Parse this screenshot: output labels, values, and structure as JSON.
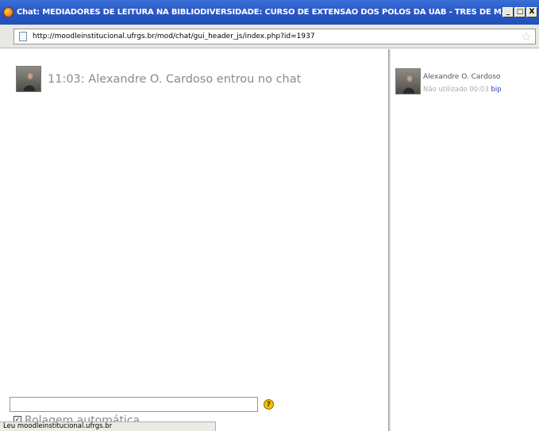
{
  "window": {
    "title": "Chat: MEDIADORES DE LEITURA NA BIBLIODIVERSIDADE: CURSO DE EXTENSÃO DOS PÓLOS DA UAB - TRES DE M....",
    "minimize_glyph": "_",
    "maximize_glyph": "□",
    "close_glyph": "X"
  },
  "address": {
    "url": "http://moodleinstitucional.ufrgs.br/mod/chat/gui_header_js/index.php?id=1937"
  },
  "messages": [
    {
      "time": "11:03",
      "text": "11:03: Alexandre O. Cardoso entrou no chat"
    }
  ],
  "users": [
    {
      "name": "Alexandre O. Cardoso",
      "status": "Não utilizado 00:03",
      "bip_label": "bip"
    }
  ],
  "input": {
    "value": "",
    "help_glyph": "?"
  },
  "autoscroll": {
    "checked": true,
    "label": "Rolagem automática"
  },
  "statusbar": {
    "text": "Leu moodleinstitucional.ufrgs.br"
  },
  "colors": {
    "titlebar": "#2a58c4",
    "message_text": "#8a8a8a",
    "link": "#2244aa"
  }
}
